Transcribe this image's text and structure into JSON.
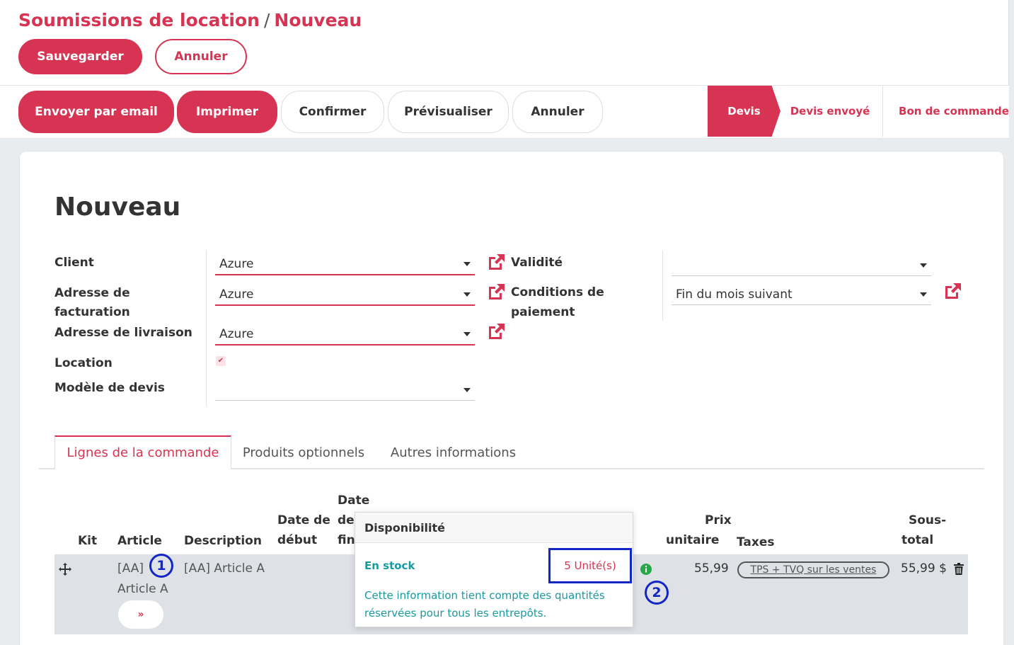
{
  "breadcrumb": {
    "parent": "Soumissions de location",
    "separator": "/",
    "current": "Nouveau"
  },
  "control": {
    "save": "Sauvegarder",
    "discard": "Annuler"
  },
  "actions": {
    "email": "Envoyer par email",
    "print": "Imprimer",
    "confirm": "Confirmer",
    "preview": "Prévisualiser",
    "cancel": "Annuler"
  },
  "statusbar": {
    "steps": [
      "Devis",
      "Devis envoyé",
      "Bon de commande"
    ],
    "active": "Devis"
  },
  "form": {
    "title": "Nouveau",
    "client": {
      "label": "Client",
      "value": "Azure"
    },
    "billing": {
      "label_1": "Adresse de",
      "label_2": "facturation",
      "value": "Azure"
    },
    "shipping": {
      "label": "Adresse de livraison",
      "value": "Azure"
    },
    "rental": {
      "label": "Location",
      "checked": true,
      "check_glyph": "✔"
    },
    "template": {
      "label": "Modèle de devis",
      "value": ""
    },
    "validity": {
      "label": "Validité",
      "value": ""
    },
    "payment_terms": {
      "label_1": "Conditions de",
      "label_2": "paiement",
      "value": "Fin du mois suivant"
    }
  },
  "tabs": [
    "Lignes de la commande",
    "Produits optionnels",
    "Autres informations"
  ],
  "table": {
    "headers": {
      "kit": "Kit",
      "article": "Article",
      "description": "Description",
      "start_1": "Date de",
      "start_2": "début",
      "end_1": "Date",
      "end_2": "de",
      "end_3": "fin",
      "price_1": "Prix",
      "price_2": "unitaire",
      "taxes": "Taxes",
      "subtotal_1": "Sous-",
      "subtotal_2": "total"
    },
    "row": {
      "article_1": "[AA]",
      "article_2": "Article A",
      "description": "[AA] Article A",
      "price": "55,99",
      "tax": "TPS + TVQ sur les ventes",
      "subtotal": "55,99 $",
      "expand_glyph": "»"
    }
  },
  "popover": {
    "title": "Disponibilité",
    "status": "En stock",
    "quantity": "5 Unité(s)",
    "note": "Cette information tient compte des quantités réservées pour tous les entrepôts."
  },
  "callouts": [
    "1",
    "2"
  ],
  "colors": {
    "accent": "#d63452",
    "callout": "#1226c5",
    "stock": "#1a9aa0"
  }
}
